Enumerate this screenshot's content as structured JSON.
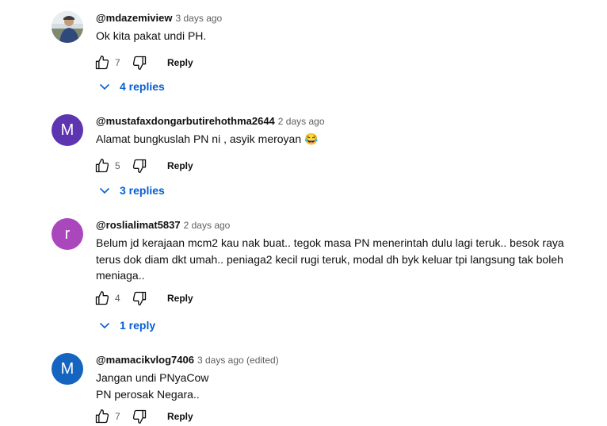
{
  "actions": {
    "reply_label": "Reply"
  },
  "colors": {
    "link_blue": "#065fd4",
    "meta_gray": "#606060"
  },
  "comments": [
    {
      "author": "@mdazemiview",
      "time": "3 days ago",
      "text": "Ok kita pakat undi PH.",
      "likes": "7",
      "replies": "4 replies",
      "avatar_type": "photo"
    },
    {
      "author": "@mustafaxdongarbutirehothma2644",
      "time": "2 days ago",
      "text": "Alamat bungkuslah PN ni , asyik meroyan 😂",
      "likes": "5",
      "replies": "3 replies",
      "avatar_letter": "M",
      "avatar_color": "#5e35b1"
    },
    {
      "author": "@roslialimat5837",
      "time": "2 days ago",
      "text": "Belum jd kerajaan mcm2 kau nak buat.. tegok masa PN menerintah dulu lagi teruk..   besok raya terus dok diam dkt umah.. peniaga2 kecil rugi teruk, modal dh byk keluar tpi langsung tak boleh meniaga..",
      "likes": "4",
      "replies": "1 reply",
      "avatar_letter": "r",
      "avatar_color": "#ab47bc"
    },
    {
      "author": "@mamacikvlog7406",
      "time": "3 days ago (edited)",
      "text": "Jangan undi PNyaCow\nPN perosak Negara..",
      "likes": "7",
      "avatar_letter": "M",
      "avatar_color": "#1565c0"
    }
  ]
}
